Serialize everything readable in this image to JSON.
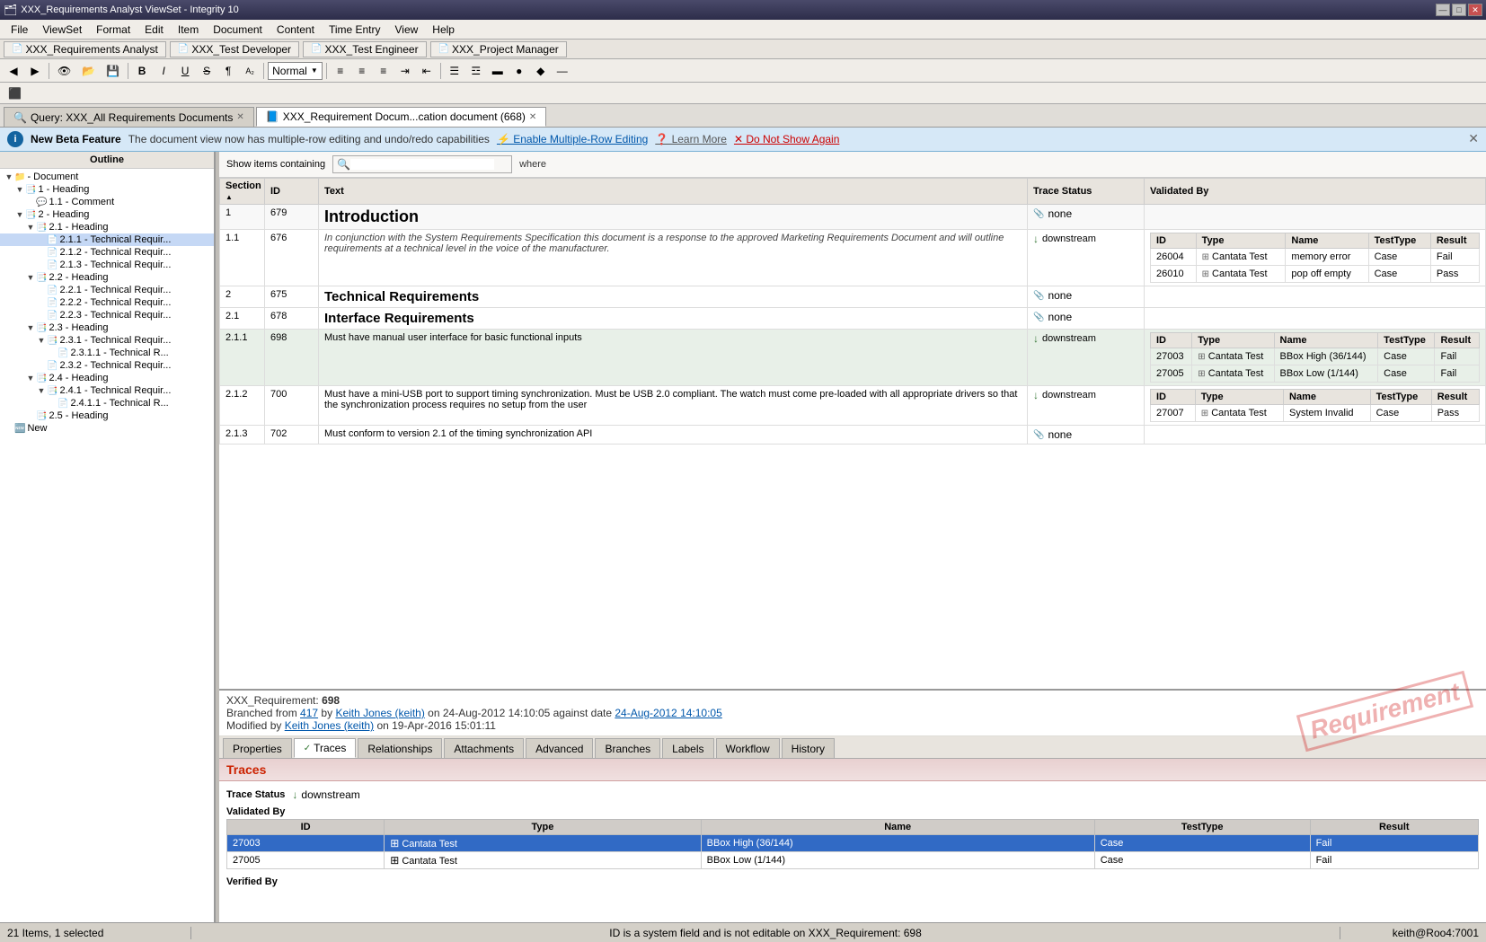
{
  "titlebar": {
    "title": "XXX_Requirements Analyst ViewSet - Integrity 10",
    "icon": "🗂",
    "min_btn": "—",
    "max_btn": "□",
    "close_btn": "✕"
  },
  "menubar": {
    "items": [
      "File",
      "ViewSet",
      "Format",
      "Edit",
      "Item",
      "Document",
      "Content",
      "Time Entry",
      "View",
      "Help"
    ]
  },
  "viewset_tabs": [
    {
      "label": "XXX_Requirements Analyst",
      "icon": "📄"
    },
    {
      "label": "XXX_Test Developer",
      "icon": "📄"
    },
    {
      "label": "XXX_Test Engineer",
      "icon": "📄"
    },
    {
      "label": "XXX_Project Manager",
      "icon": "📄"
    }
  ],
  "toolbar": {
    "normal_dropdown": "Normal",
    "bold": "B",
    "italic": "I",
    "underline": "U",
    "strikethrough": "S"
  },
  "doc_tabs": [
    {
      "label": "Query: XXX_All Requirements Documents",
      "active": false,
      "icon": "🔍"
    },
    {
      "label": "XXX_Requirement Docum...cation document (668)",
      "active": true,
      "icon": "📘"
    }
  ],
  "beta_notice": {
    "title": "New Beta Feature",
    "description": "The document view now has multiple-row editing and undo/redo capabilities",
    "link1": "⚡ Enable Multiple-Row Editing",
    "link2": "❓ Learn More",
    "link3": "✖ Do Not Show Again"
  },
  "outline": {
    "header": "Outline",
    "items": [
      {
        "id": "doc-root",
        "label": "- Document",
        "level": 0,
        "icon": "📁",
        "expanded": true
      },
      {
        "id": "h1",
        "label": "1 - Heading",
        "level": 1,
        "icon": "📑",
        "expanded": true
      },
      {
        "id": "h1-1",
        "label": "1.1 - Comment",
        "level": 2,
        "icon": "💬"
      },
      {
        "id": "h2",
        "label": "2 - Heading",
        "level": 1,
        "icon": "📑",
        "expanded": true
      },
      {
        "id": "h2-1",
        "label": "2.1 - Heading",
        "level": 2,
        "icon": "📑",
        "expanded": true
      },
      {
        "id": "h2-1-1",
        "label": "2.1.1 - Technical Requir...",
        "level": 3,
        "icon": "📄",
        "selected": true
      },
      {
        "id": "h2-1-2",
        "label": "2.1.2 - Technical Requir...",
        "level": 3,
        "icon": "📄"
      },
      {
        "id": "h2-1-3",
        "label": "2.1.3 - Technical Requir...",
        "level": 3,
        "icon": "📄"
      },
      {
        "id": "h2-2",
        "label": "2.2 - Heading",
        "level": 2,
        "icon": "📑",
        "expanded": true
      },
      {
        "id": "h2-2-1",
        "label": "2.2.1 - Technical Requir...",
        "level": 3,
        "icon": "📄"
      },
      {
        "id": "h2-2-2",
        "label": "2.2.2 - Technical Requir...",
        "level": 3,
        "icon": "📄"
      },
      {
        "id": "h2-2-3",
        "label": "2.2.3 - Technical Requir...",
        "level": 3,
        "icon": "📄"
      },
      {
        "id": "h2-3",
        "label": "2.3 - Heading",
        "level": 2,
        "icon": "📑",
        "expanded": true
      },
      {
        "id": "h2-3-1",
        "label": "2.3.1 - Technical Requir...",
        "level": 3,
        "icon": "📑",
        "expanded": true
      },
      {
        "id": "h2-3-1-1",
        "label": "2.3.1.1 - Technical R...",
        "level": 4,
        "icon": "📄"
      },
      {
        "id": "h2-3-2",
        "label": "2.3.2 - Technical Requir...",
        "level": 3,
        "icon": "📄"
      },
      {
        "id": "h2-4",
        "label": "2.4 - Heading",
        "level": 2,
        "icon": "📑",
        "expanded": true
      },
      {
        "id": "h2-4-1",
        "label": "2.4.1 - Technical Requir...",
        "level": 3,
        "icon": "📑",
        "expanded": true
      },
      {
        "id": "h2-4-1-1",
        "label": "2.4.1.1 - Technical R...",
        "level": 4,
        "icon": "📄"
      },
      {
        "id": "h2-5",
        "label": "2.5 - Heading",
        "level": 2,
        "icon": "📑"
      },
      {
        "id": "new",
        "label": "New",
        "level": 0,
        "icon": "🆕"
      }
    ]
  },
  "filter": {
    "label": "Show items containing",
    "placeholder": "",
    "where_label": "where"
  },
  "table": {
    "headers": [
      "Section",
      "ID",
      "Text",
      "Trace Status",
      "Validated By"
    ],
    "rows": [
      {
        "section": "1",
        "id": "679",
        "text": "Introduction",
        "text_style": "heading1",
        "trace_status": "none",
        "validated": null
      },
      {
        "section": "1.1",
        "id": "676",
        "text": "In conjunction with the System Requirements Specification this document is a response to the approved Marketing Requirements Document and will outline requirements at a technical level in the voice of the manufacturer.",
        "text_style": "italic",
        "trace_status": "downstream",
        "validated": [
          {
            "header": true,
            "id": "ID",
            "type": "Type",
            "name": "Name",
            "testtype": "TestType",
            "result": "Result"
          },
          {
            "id": "26004",
            "type": "Cantata Test",
            "name": "memory error",
            "testtype": "Case",
            "result": "Fail"
          },
          {
            "id": "26010",
            "type": "Cantata Test",
            "name": "pop off empty",
            "testtype": "Case",
            "result": "Pass"
          }
        ]
      },
      {
        "section": "2",
        "id": "675",
        "text": "Technical Requirements",
        "text_style": "heading2",
        "trace_status": "none",
        "validated": null
      },
      {
        "section": "2.1",
        "id": "678",
        "text": "Interface Requirements",
        "text_style": "heading2",
        "trace_status": "none",
        "validated": null
      },
      {
        "section": "2.1.1",
        "id": "698",
        "text": "Must have manual user interface for basic functional inputs",
        "text_style": "normal",
        "trace_status": "downstream",
        "row_highlight": true,
        "validated": [
          {
            "header": true,
            "id": "ID",
            "type": "Type",
            "name": "Name",
            "testtype": "TestType",
            "result": "Result"
          },
          {
            "id": "27003",
            "type": "Cantata Test",
            "name": "BBox High (36/144)",
            "testtype": "Case",
            "result": "Fail"
          },
          {
            "id": "27005",
            "type": "Cantata Test",
            "name": "BBox Low (1/144)",
            "testtype": "Case",
            "result": "Fail"
          }
        ]
      },
      {
        "section": "2.1.2",
        "id": "700",
        "text": "Must have a mini-USB port to support timing synchronization. Must be USB 2.0 compliant. The watch must come pre-loaded with all appropriate drivers so that the synchronization process requires no setup from the user",
        "text_style": "normal",
        "trace_status": "downstream",
        "validated": [
          {
            "header": true,
            "id": "ID",
            "type": "Type",
            "name": "Name",
            "testtype": "TestType",
            "result": "Result"
          },
          {
            "id": "27007",
            "type": "Cantata Test",
            "name": "System Invalid",
            "testtype": "Case",
            "result": "Pass"
          }
        ]
      },
      {
        "section": "2.1.3",
        "id": "702",
        "text": "Must conform to version 2.1 of the timing synchronization API",
        "text_style": "normal",
        "trace_status": "none",
        "validated": null
      }
    ]
  },
  "detail": {
    "req_id_label": "XXX_Requirement:",
    "req_id": "698",
    "branched_text": "Branched from",
    "branched_from": "417",
    "branched_by": "Keith Jones (keith)",
    "branched_date": "24-Aug-2012 14:10:05",
    "against_date_label": "against date",
    "against_date": "24-Aug-2012 14:10:05",
    "modified_by_label": "Modified by",
    "modified_by": "Keith Jones (keith)",
    "modified_date": "on 19-Apr-2016 15:01:11",
    "watermark": "Requirement",
    "tabs": [
      "Properties",
      "Traces",
      "Relationships",
      "Attachments",
      "Advanced",
      "Branches",
      "Labels",
      "Workflow",
      "History"
    ],
    "active_tab": "Traces",
    "traces": {
      "section_title": "Traces",
      "trace_status_label": "Trace Status",
      "trace_status": "downstream",
      "trace_icon": "↓",
      "validated_by_label": "Validated By",
      "table_headers": [
        "ID",
        "Type",
        "Name",
        "TestType",
        "Result"
      ],
      "rows": [
        {
          "id": "27003",
          "type": "Cantata Test",
          "name": "BBox High (36/144)",
          "testtype": "Case",
          "result": "Fail",
          "selected": true
        },
        {
          "id": "27005",
          "type": "Cantata Test",
          "name": "BBox Low (1/144)",
          "testtype": "Case",
          "result": "Fail"
        }
      ],
      "verified_by_label": "Verified By"
    }
  },
  "statusbar": {
    "left": "21 Items, 1 selected",
    "mid": "ID is a system field and is not editable on XXX_Requirement: 698",
    "right": "keith@Roo4:7001"
  }
}
